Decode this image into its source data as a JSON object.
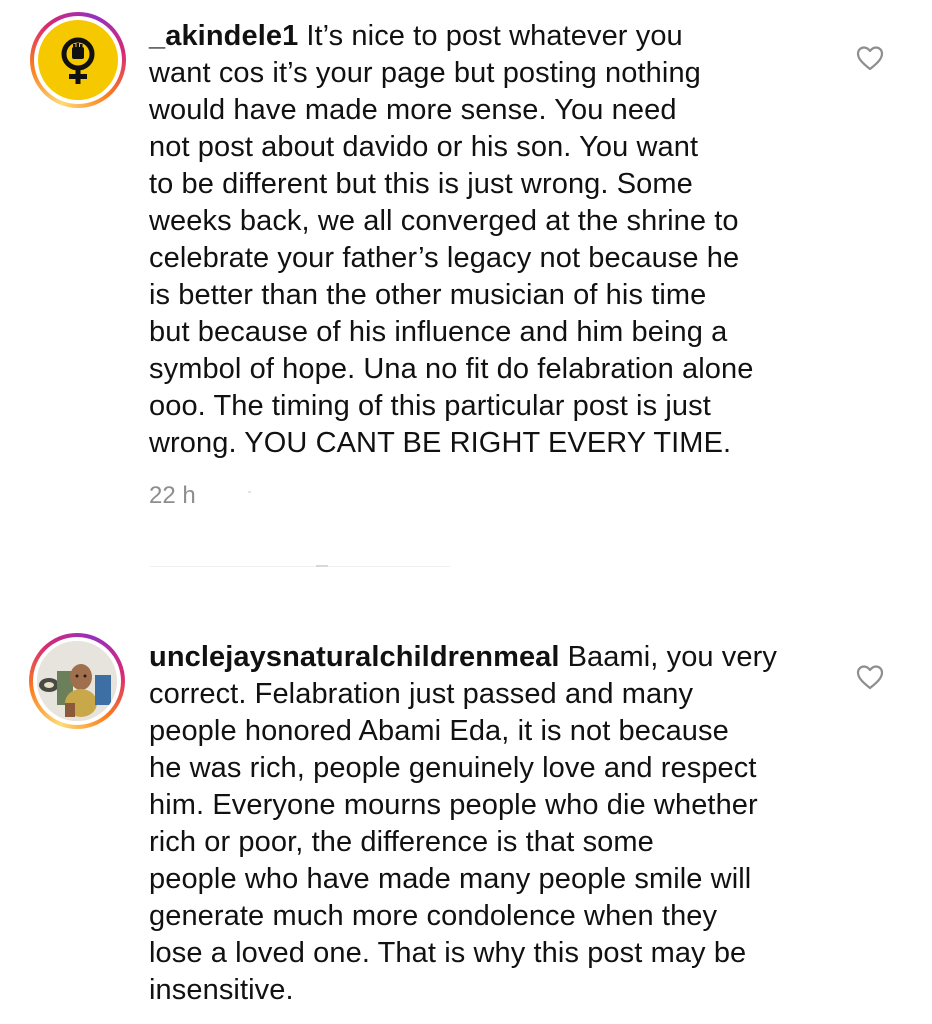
{
  "comments": [
    {
      "username": "_akindele1",
      "lines": [
        "It’s nice to post whatever you",
        "want cos it’s your page but posting nothing",
        "would have made more sense. You need",
        "not post about davido or his son. You want",
        "to be different but this is just wrong. Some",
        "weeks back, we all converged at the shrine to",
        "celebrate your father’s legacy not because he",
        "is better than the other musician of his time",
        "but because of his influence and him being a",
        "symbol of hope. Una no fit do felabration alone",
        "ooo. The timing of this particular post is just",
        "wrong. YOU CANT BE RIGHT EVERY TIME."
      ],
      "time": "22 h",
      "avatar_icon": "raised-fist-female-symbol-icon"
    },
    {
      "username": "unclejaysnaturalchildrenmeal",
      "lines": [
        "Baami, you very",
        "correct. Felabration just passed and many",
        "people honored Abami Eda, it is not because",
        "he was rich, people genuinely love and respect",
        "him. Everyone mourns people who die whether",
        "rich or poor, the difference is that some",
        "people who have made many people smile will",
        "generate much more condolence when they",
        "lose a loved one.  That is why this post may be",
        "insensitive."
      ],
      "avatar_icon": "child-photo-avatar"
    }
  ],
  "colors": {
    "text": "#111111",
    "meta": "#8e8e8e",
    "avatar_yellow": "#f5c800",
    "heart": "#8e8e8e"
  }
}
